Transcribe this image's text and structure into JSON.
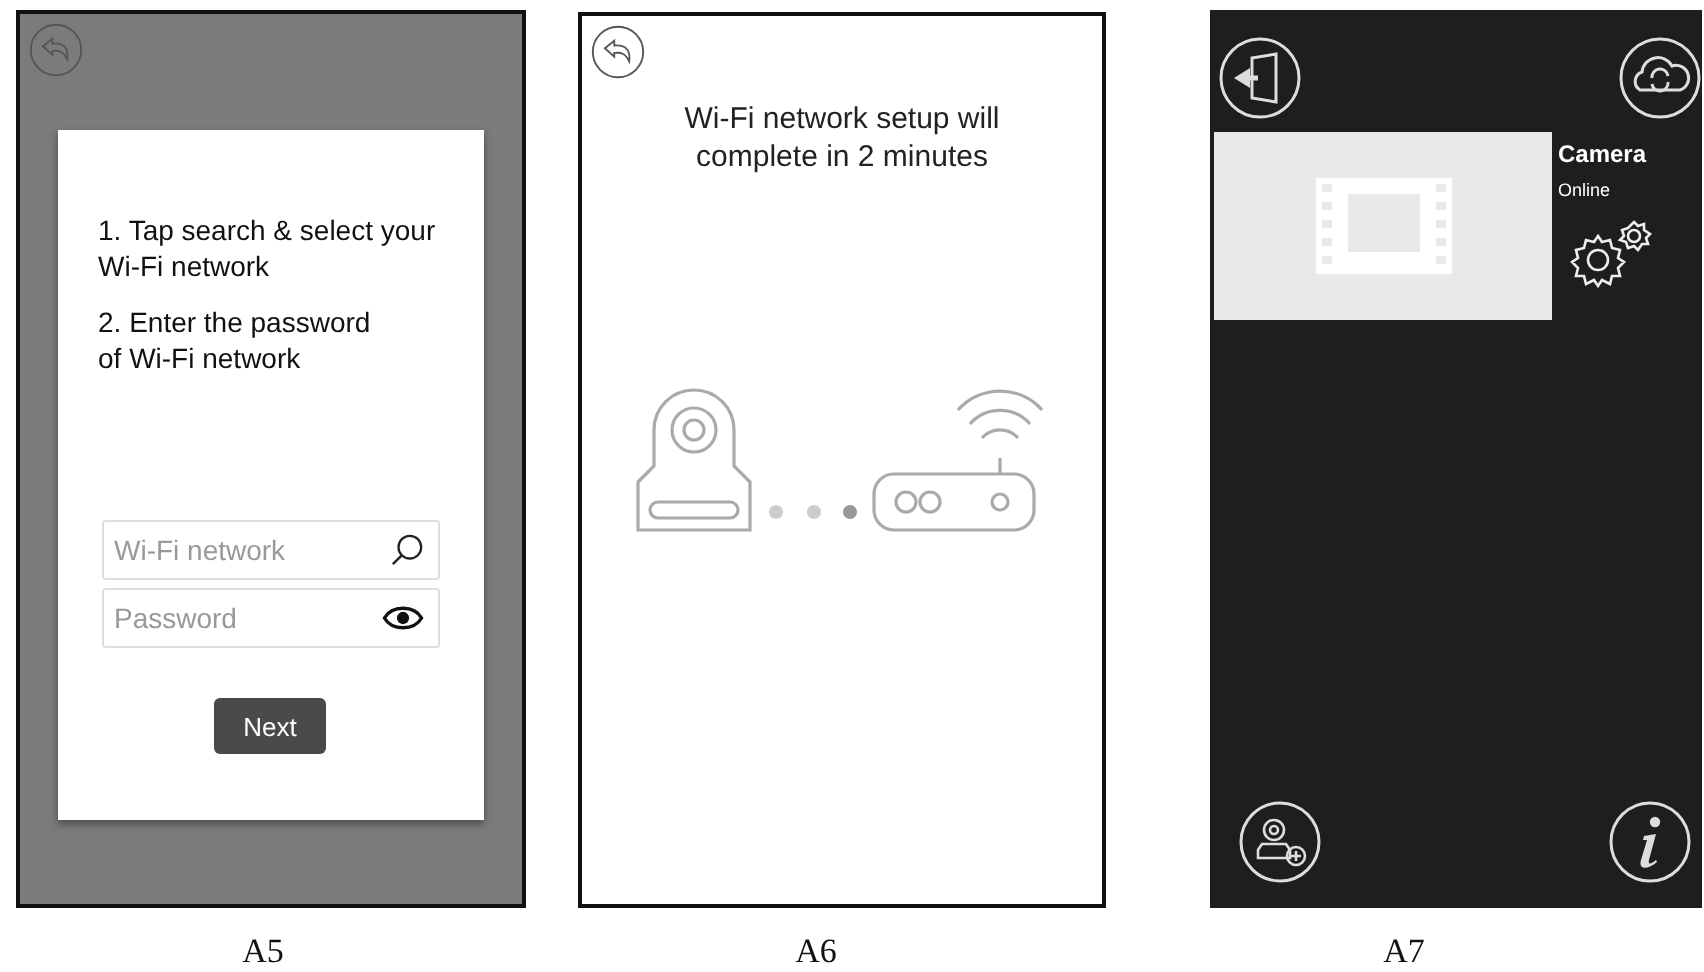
{
  "screens": [
    {
      "kind": "wifi_form",
      "caption": "A5",
      "dialog": {
        "steps": [
          "1. Tap search & select your Wi-Fi network",
          "2. Enter the password of Wi-Fi network"
        ],
        "fields": [
          {
            "kind": "search",
            "placeholder": "Wi-Fi network"
          },
          {
            "kind": "password",
            "placeholder": "Password"
          }
        ],
        "button": "Next"
      }
    },
    {
      "kind": "progress",
      "caption": "A6",
      "message": "Wi-Fi network setup will complete in 2 minutes"
    },
    {
      "kind": "camera_list",
      "caption": "A7",
      "cameras": [
        {
          "name": "Camera",
          "status": "Online"
        }
      ]
    }
  ]
}
